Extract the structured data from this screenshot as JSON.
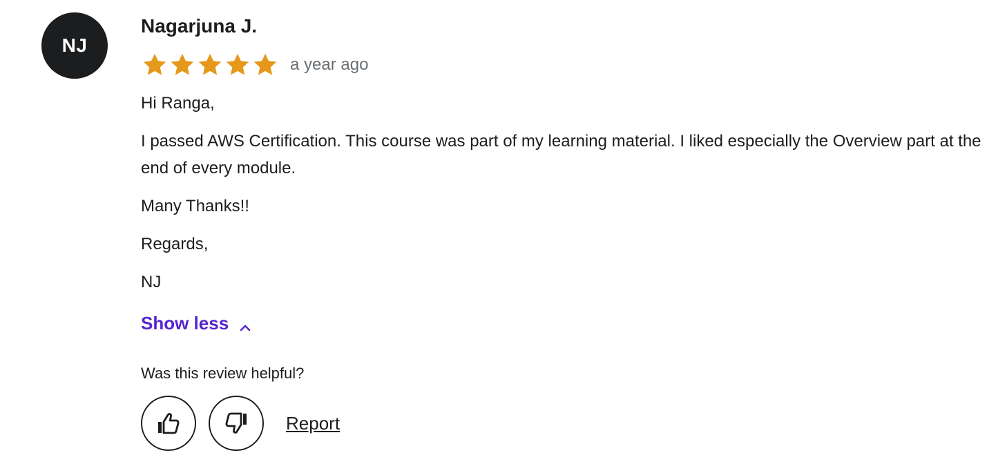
{
  "review": {
    "avatar_initials": "NJ",
    "reviewer_name": "Nagarjuna J.",
    "rating": 5,
    "rating_max": 5,
    "star_color": "#e59819",
    "time_ago": "a year ago",
    "paragraphs": [
      "Hi Ranga,",
      "I passed AWS Certification. This course was part of my learning material. I liked especially the Overview part at the end of every module.",
      "Many Thanks!!",
      "Regards,",
      "NJ"
    ],
    "show_less_label": "Show less",
    "show_less_icon": "chevron-up-icon",
    "accent_color": "#5624d0",
    "helpful_label": "Was this review helpful?",
    "thumbs_up_icon": "thumbs-up-icon",
    "thumbs_down_icon": "thumbs-down-icon",
    "report_label": "Report"
  }
}
